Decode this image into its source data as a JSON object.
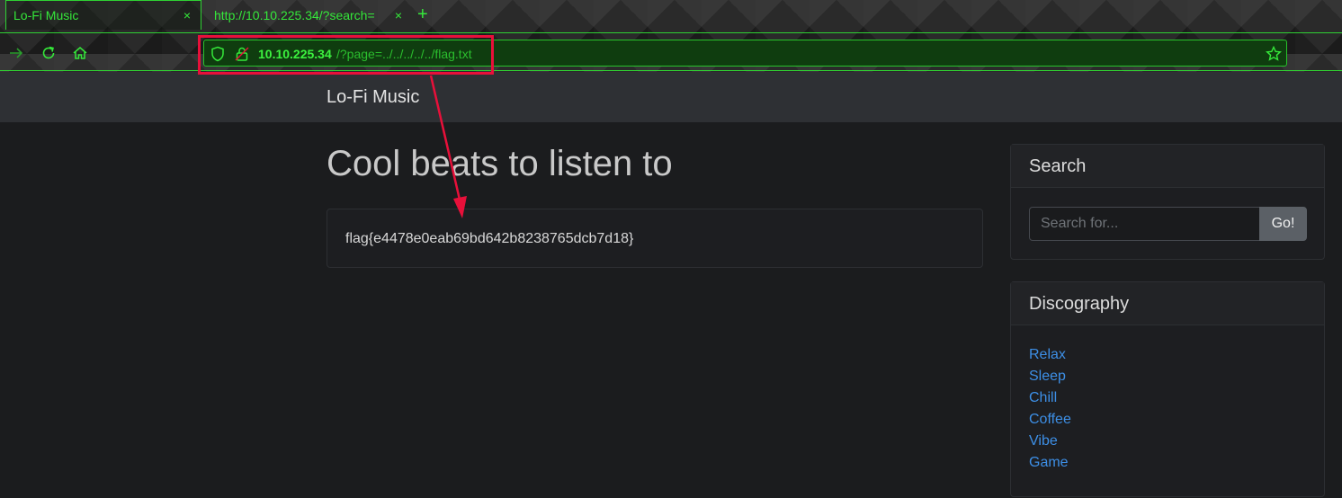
{
  "browser": {
    "tabs": [
      {
        "label": "Lo-Fi Music",
        "close": "×"
      },
      {
        "label": "http://10.10.225.34/?search=",
        "close": "×"
      }
    ],
    "new_tab": "+",
    "url_host": "10.10.225.34",
    "url_path": "/?page=../../../../../flag.txt",
    "accent_color": "#35e83a"
  },
  "annotation": {
    "color": "#e8103a"
  },
  "site": {
    "brand": "Lo-Fi Music",
    "heading": "Cool beats to listen to",
    "content": "flag{e4478e0eab69bd642b8238765dcb7d18}",
    "search": {
      "title": "Search",
      "placeholder": "Search for...",
      "button": "Go!"
    },
    "discography": {
      "title": "Discography",
      "items": [
        "Relax",
        "Sleep",
        "Chill",
        "Coffee",
        "Vibe",
        "Game"
      ]
    }
  }
}
